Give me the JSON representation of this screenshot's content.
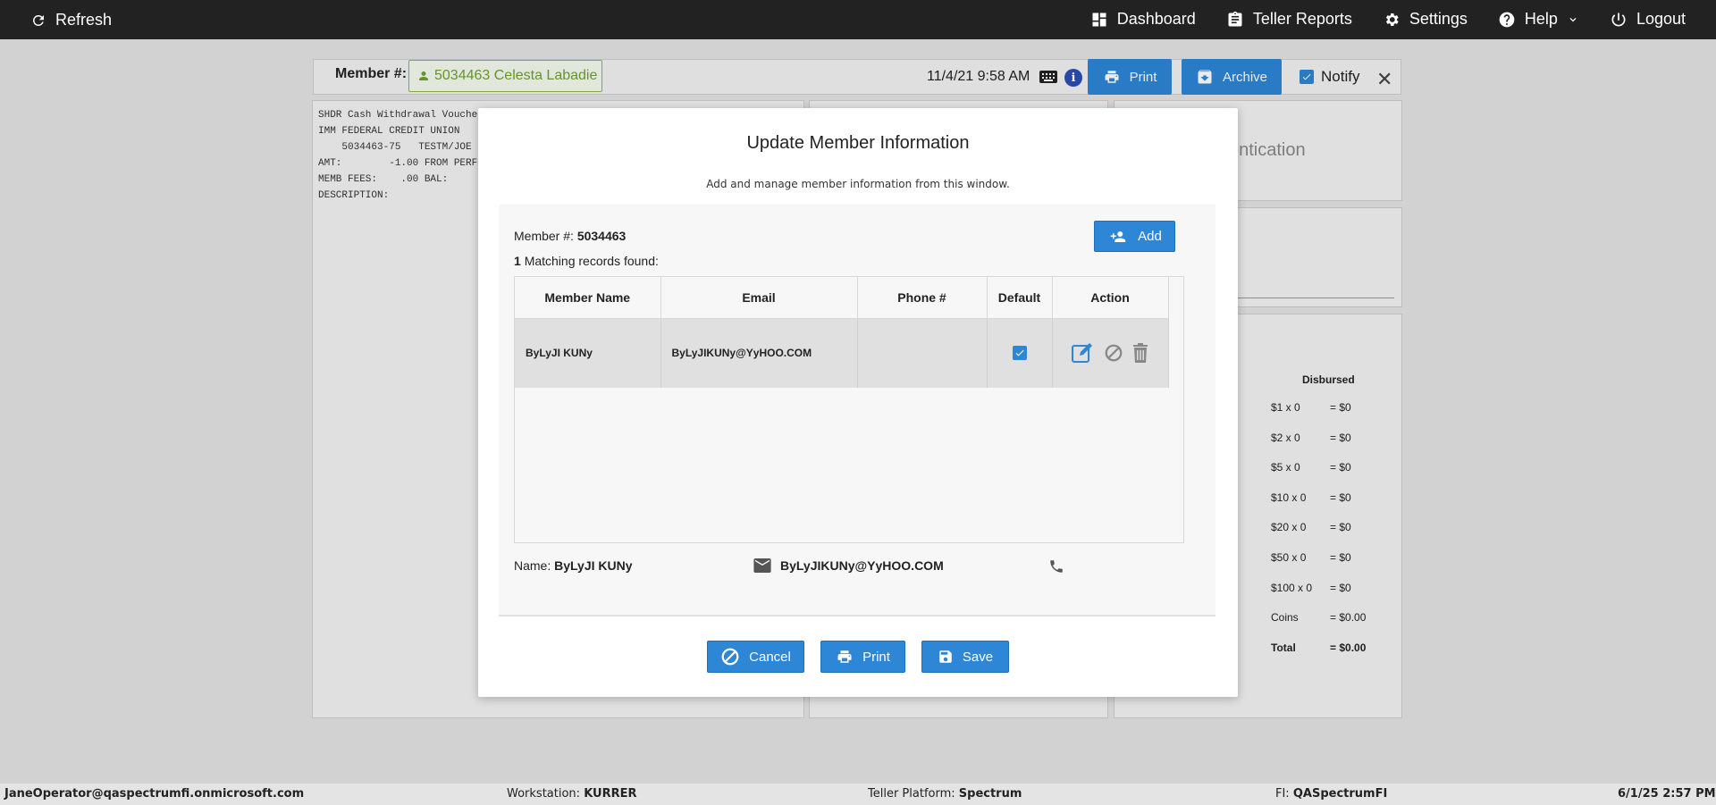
{
  "topbar": {
    "refresh_label": "Refresh",
    "dashboard_label": "Dashboard",
    "teller_reports_label": "Teller Reports",
    "settings_label": "Settings",
    "help_label": "Help",
    "logout_label": "Logout"
  },
  "header": {
    "member_label": "Member #:",
    "member_chip": "5034463 Celesta Labadie",
    "datetime": "11/4/21 9:58 AM",
    "print_label": "Print",
    "archive_label": "Archive",
    "notify_label": "Notify"
  },
  "background": {
    "receipt_lines": [
      "SHDR Cash Withdrawal Vouche",
      "IMM FEDERAL CREDIT UNION",
      "    5034463-75   TESTM/JOE",
      "AMT:        -1.00 FROM PERF",
      "MEMB FEES:    .00 BAL:",
      "DESCRIPTION:"
    ],
    "auth_partial": "entication",
    "cash_header": "Disbursed",
    "cash_rows": [
      {
        "label": "$1 x 0",
        "value": "= $0"
      },
      {
        "label": "$2 x 0",
        "value": "= $0"
      },
      {
        "label": "$5 x 0",
        "value": "= $0"
      },
      {
        "label": "$10 x 0",
        "value": "= $0"
      },
      {
        "label": "$20 x 0",
        "value": "= $0"
      },
      {
        "label": "$50 x 0",
        "value": "= $0"
      },
      {
        "label": "$100 x 0",
        "value": "= $0"
      },
      {
        "label": "Coins",
        "value": "= $0.00"
      },
      {
        "label": "Total",
        "value": "= $0.00"
      }
    ]
  },
  "modal": {
    "title": "Update Member Information",
    "subtitle": "Add and manage member information from this window.",
    "member_label": "Member #:",
    "member_number": "5034463",
    "match_count": "1",
    "match_text": "Matching records found:",
    "add_label": "Add",
    "columns": [
      "Member Name",
      "Email",
      "Phone #",
      "Default",
      "Action"
    ],
    "rows": [
      {
        "name": "ByLyJI KUNy",
        "email": "ByLyJIKUNy@YyHOO.COM",
        "phone": "",
        "default": true
      }
    ],
    "detail_name_label": "Name:",
    "detail_name": "ByLyJI KUNy",
    "detail_email": "ByLyJIKUNy@YyHOO.COM",
    "cancel_label": "Cancel",
    "print_label": "Print",
    "save_label": "Save"
  },
  "status": {
    "user": "JaneOperator@qaspectrumfi.onmicrosoft.com",
    "workstation_label": "Workstation:",
    "workstation": "KURRER",
    "platform_label": "Teller Platform:",
    "platform": "Spectrum",
    "fi_label": "FI:",
    "fi": "QASpectrumFI",
    "datetime": "6/1/25 2:57 PM"
  },
  "colors": {
    "topbar": "#222222",
    "accent": "#2e86d6",
    "member_chip": "#6ea12e"
  }
}
